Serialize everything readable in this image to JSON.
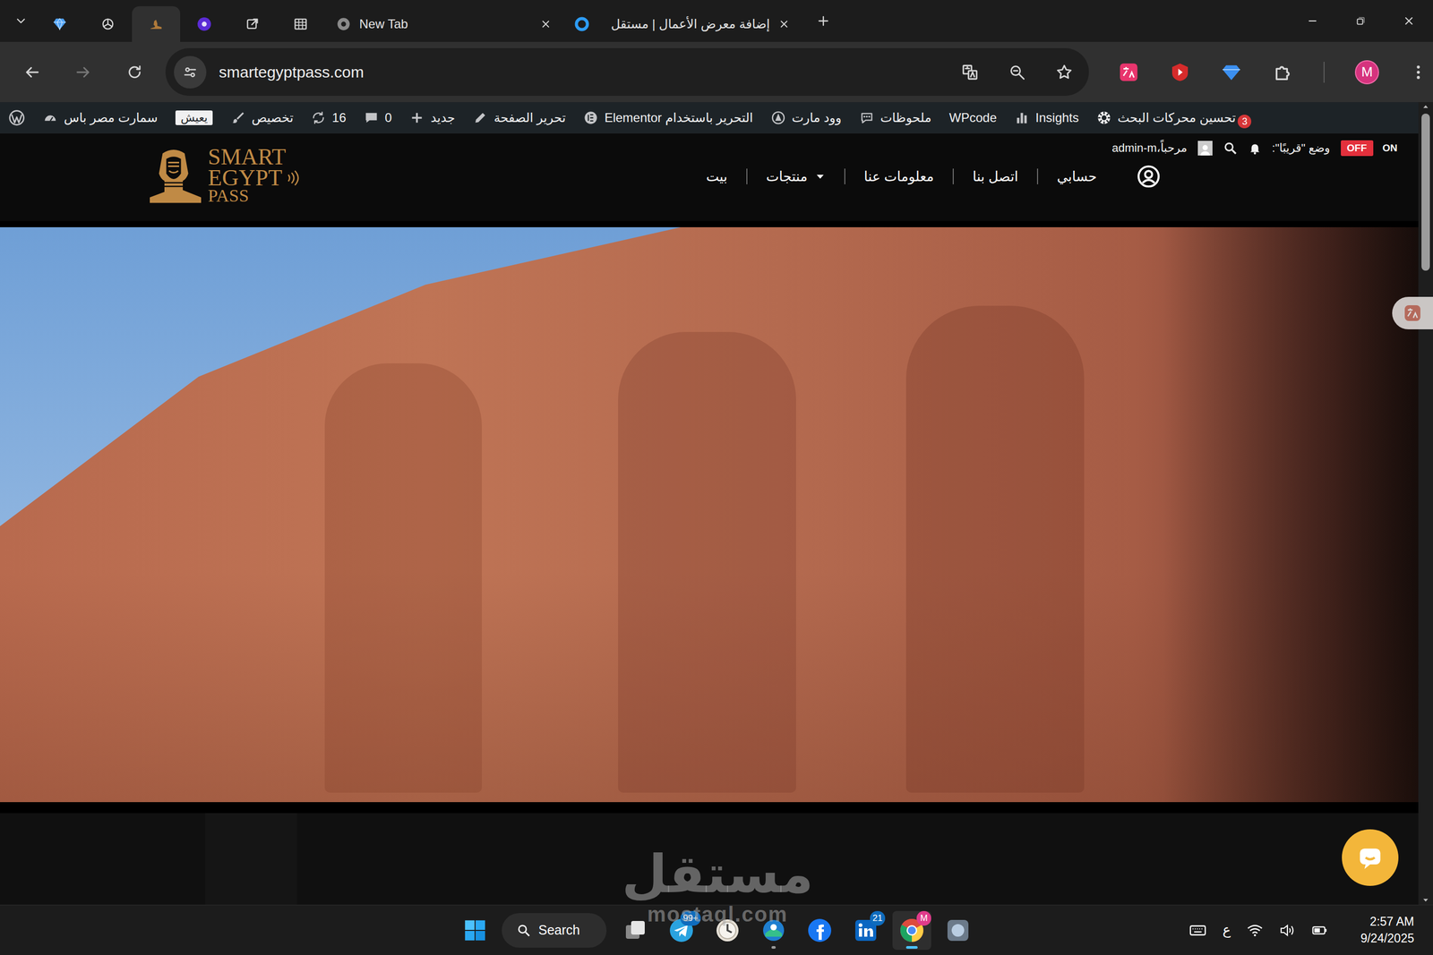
{
  "browser": {
    "tabs": [
      {
        "kind": "pinned",
        "selected": false
      },
      {
        "kind": "pinned",
        "selected": false
      },
      {
        "kind": "pinned",
        "selected": true
      },
      {
        "kind": "pinned",
        "selected": false
      },
      {
        "kind": "pinned",
        "selected": false
      },
      {
        "kind": "pinned",
        "selected": false
      },
      {
        "kind": "labeled",
        "label": "New Tab",
        "selected": false
      },
      {
        "kind": "labeled",
        "label": "إضافة معرض الأعمال | مستقل",
        "selected": false
      }
    ],
    "url": "smartegyptpass.com",
    "profile_initial": "M"
  },
  "admin_bar": {
    "items": [
      {
        "label": "سمارت مصر باس",
        "kind": "link"
      },
      {
        "label": "يعيش",
        "kind": "pill"
      },
      {
        "label": "تخصيص",
        "kind": "link"
      },
      {
        "label": "16",
        "kind": "link"
      },
      {
        "label": "0",
        "kind": "link"
      },
      {
        "label": "جديد",
        "kind": "link"
      },
      {
        "label": "تحرير الصفحة",
        "kind": "link"
      },
      {
        "label": "التحرير باستخدام Elementor",
        "kind": "link"
      },
      {
        "label": "وود مارت",
        "kind": "link"
      },
      {
        "label": "ملحوظات",
        "kind": "link"
      },
      {
        "label": "WPcode",
        "kind": "link"
      },
      {
        "label": "Insights",
        "kind": "link"
      },
      {
        "label": "تحسين محركات البحث",
        "kind": "link",
        "badge": "3"
      }
    ]
  },
  "site_header": {
    "logo": [
      "SMART",
      "EGYPT",
      "PASS"
    ],
    "coming_soon": {
      "label": "وضع \"قريبًا\":",
      "off_label": "OFF",
      "on_label": "ON",
      "on": false
    },
    "greeting": "مرحباً،admin-m",
    "nav": [
      {
        "label": "بيت",
        "dropdown": false
      },
      {
        "label": "منتجات",
        "dropdown": true
      },
      {
        "label": "معلومات عنا",
        "dropdown": false
      },
      {
        "label": "اتصل بنا",
        "dropdown": false
      },
      {
        "label": "حسابي",
        "dropdown": false
      }
    ]
  },
  "watermark": {
    "title": "مستقل",
    "domain": "mostaql.com"
  },
  "taskbar": {
    "search": "Search",
    "apps": [
      {
        "active": false,
        "running": false
      },
      {
        "active": false,
        "running": false,
        "badge": "99+"
      },
      {
        "active": false,
        "running": false
      },
      {
        "active": false,
        "running": true
      },
      {
        "active": false,
        "running": false
      },
      {
        "active": false,
        "running": false,
        "badge": "21"
      },
      {
        "active": true,
        "running": true,
        "badge": "M"
      },
      {
        "active": false,
        "running": false
      }
    ],
    "language": "ع",
    "time": "2:57 AM",
    "date": "9/24/2025"
  }
}
